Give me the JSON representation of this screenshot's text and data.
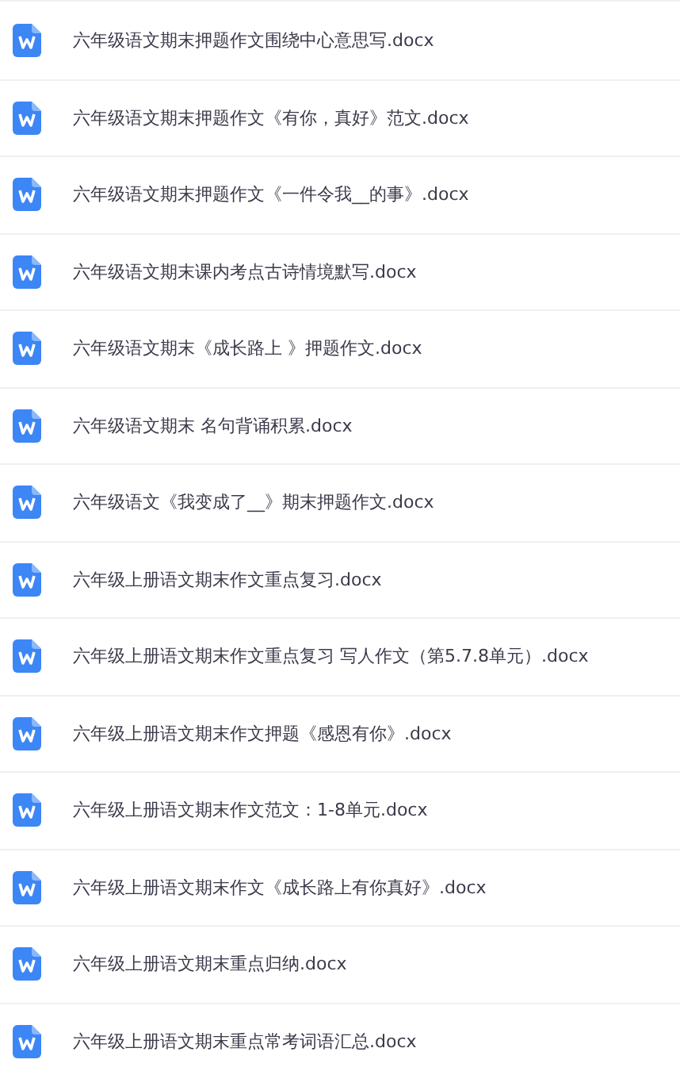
{
  "files": [
    {
      "name": "六年级语文期末押题作文围绕中心意思写.docx"
    },
    {
      "name": "六年级语文期末押题作文《有你，真好》范文.docx"
    },
    {
      "name": "六年级语文期末押题作文《一件令我__的事》.docx"
    },
    {
      "name": "六年级语文期末课内考点古诗情境默写.docx"
    },
    {
      "name": "六年级语文期末《成长路上 》押题作文.docx"
    },
    {
      "name": "六年级语文期末 名句背诵积累.docx"
    },
    {
      "name": "六年级语文《我变成了__》期末押题作文.docx"
    },
    {
      "name": "六年级上册语文期末作文重点复习.docx"
    },
    {
      "name": "六年级上册语文期末作文重点复习 写人作文（第5.7.8单元）.docx"
    },
    {
      "name": "六年级上册语文期末作文押题《感恩有你》.docx"
    },
    {
      "name": "六年级上册语文期末作文范文：1-8单元.docx"
    },
    {
      "name": "六年级上册语文期末作文《成长路上有你真好》.docx"
    },
    {
      "name": "六年级上册语文期末重点归纳.docx"
    },
    {
      "name": "六年级上册语文期末重点常考词语汇总.docx"
    }
  ]
}
